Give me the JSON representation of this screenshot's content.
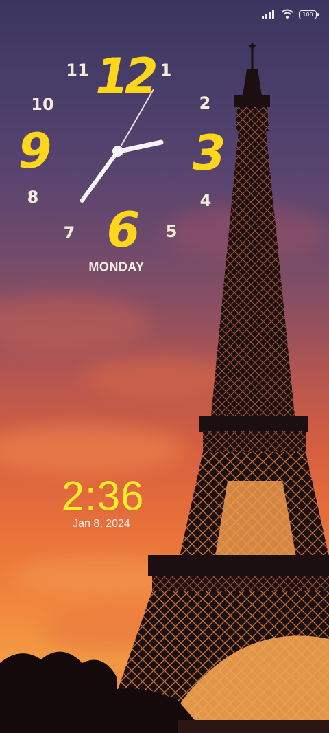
{
  "status_bar": {
    "icons": [
      "signal-icon",
      "wifi-icon"
    ],
    "battery_level": "100"
  },
  "analog_clock": {
    "numerals": {
      "n1": "1",
      "n2": "2",
      "n3": "3",
      "n4": "4",
      "n5": "5",
      "n6": "6",
      "n7": "7",
      "n8": "8",
      "n9": "9",
      "n10": "10",
      "n11": "11",
      "n12": "12"
    },
    "time_shown": {
      "hour": 2,
      "minute": 36,
      "second": 5
    },
    "day": "MONDAY",
    "colors": {
      "small_numerals": "#f4ecd8",
      "big_numerals": "#ffd71a",
      "hands": "#f6f6f6",
      "second_hand": "#e9e0e0"
    }
  },
  "digital_clock": {
    "time": "2:36",
    "date": "Jan 8, 2024",
    "colors": {
      "time": "#ffec2b",
      "date": "#f7f2ee"
    }
  },
  "wallpaper": {
    "subject": "eiffel-tower-sunset",
    "colors": {
      "sky_top": "#3b3560",
      "sky_bottom": "#f39b45",
      "silhouette": "#1b0f12"
    }
  }
}
